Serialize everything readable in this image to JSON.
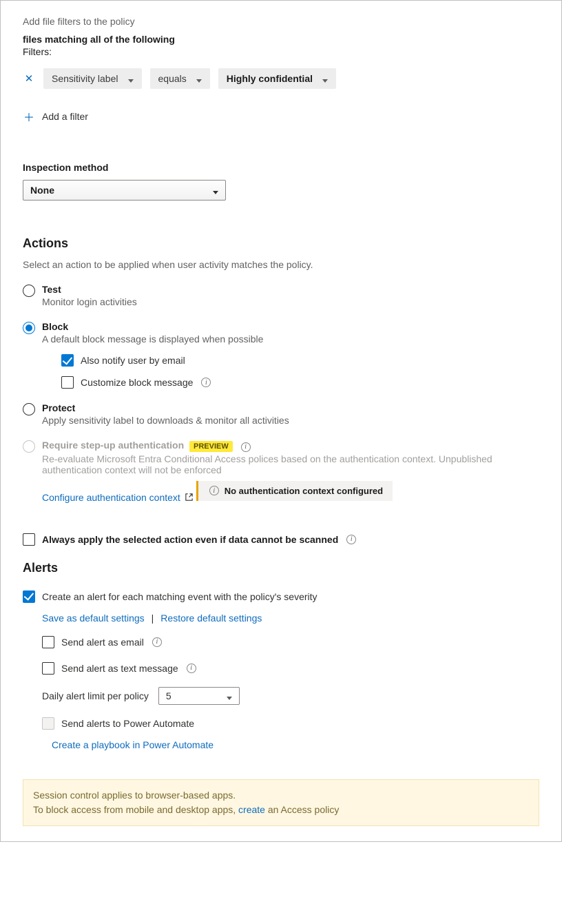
{
  "filters": {
    "intro": "Add file filters to the policy",
    "heading": "files matching all of the following",
    "label": "Filters:",
    "row": {
      "field": "Sensitivity label",
      "op": "equals",
      "value": "Highly confidential"
    },
    "add": "Add a filter"
  },
  "inspection": {
    "label": "Inspection method",
    "value": "None"
  },
  "actions": {
    "title": "Actions",
    "desc": "Select an action to be applied when user activity matches the policy.",
    "test": {
      "title": "Test",
      "sub": "Monitor login activities"
    },
    "block": {
      "title": "Block",
      "sub": "A default block message is displayed when possible",
      "notify": "Also notify user by email",
      "custom": "Customize block message"
    },
    "protect": {
      "title": "Protect",
      "sub": "Apply sensitivity label to downloads & monitor all activities"
    },
    "stepup": {
      "title": "Require step-up authentication",
      "badge": "PREVIEW",
      "sub": "Re-evaluate Microsoft Entra Conditional Access polices based on the authentication context. Unpublished authentication context will not be enforced",
      "link": "Configure authentication context",
      "warn": "No authentication context configured"
    },
    "always": "Always apply the selected action even if data cannot be scanned"
  },
  "alerts": {
    "title": "Alerts",
    "create": "Create an alert for each matching event with the policy's severity",
    "save": "Save as default settings",
    "restore": "Restore default settings",
    "email": "Send alert as email",
    "sms": "Send alert as text message",
    "dailyLabel": "Daily alert limit per policy",
    "dailyValue": "5",
    "power": "Send alerts to Power Automate",
    "playbook": "Create a playbook in Power Automate"
  },
  "note": {
    "line1": "Session control applies to browser-based apps.",
    "line2a": "To block access from mobile and desktop apps, ",
    "link": "create",
    "line2b": " an Access policy"
  }
}
